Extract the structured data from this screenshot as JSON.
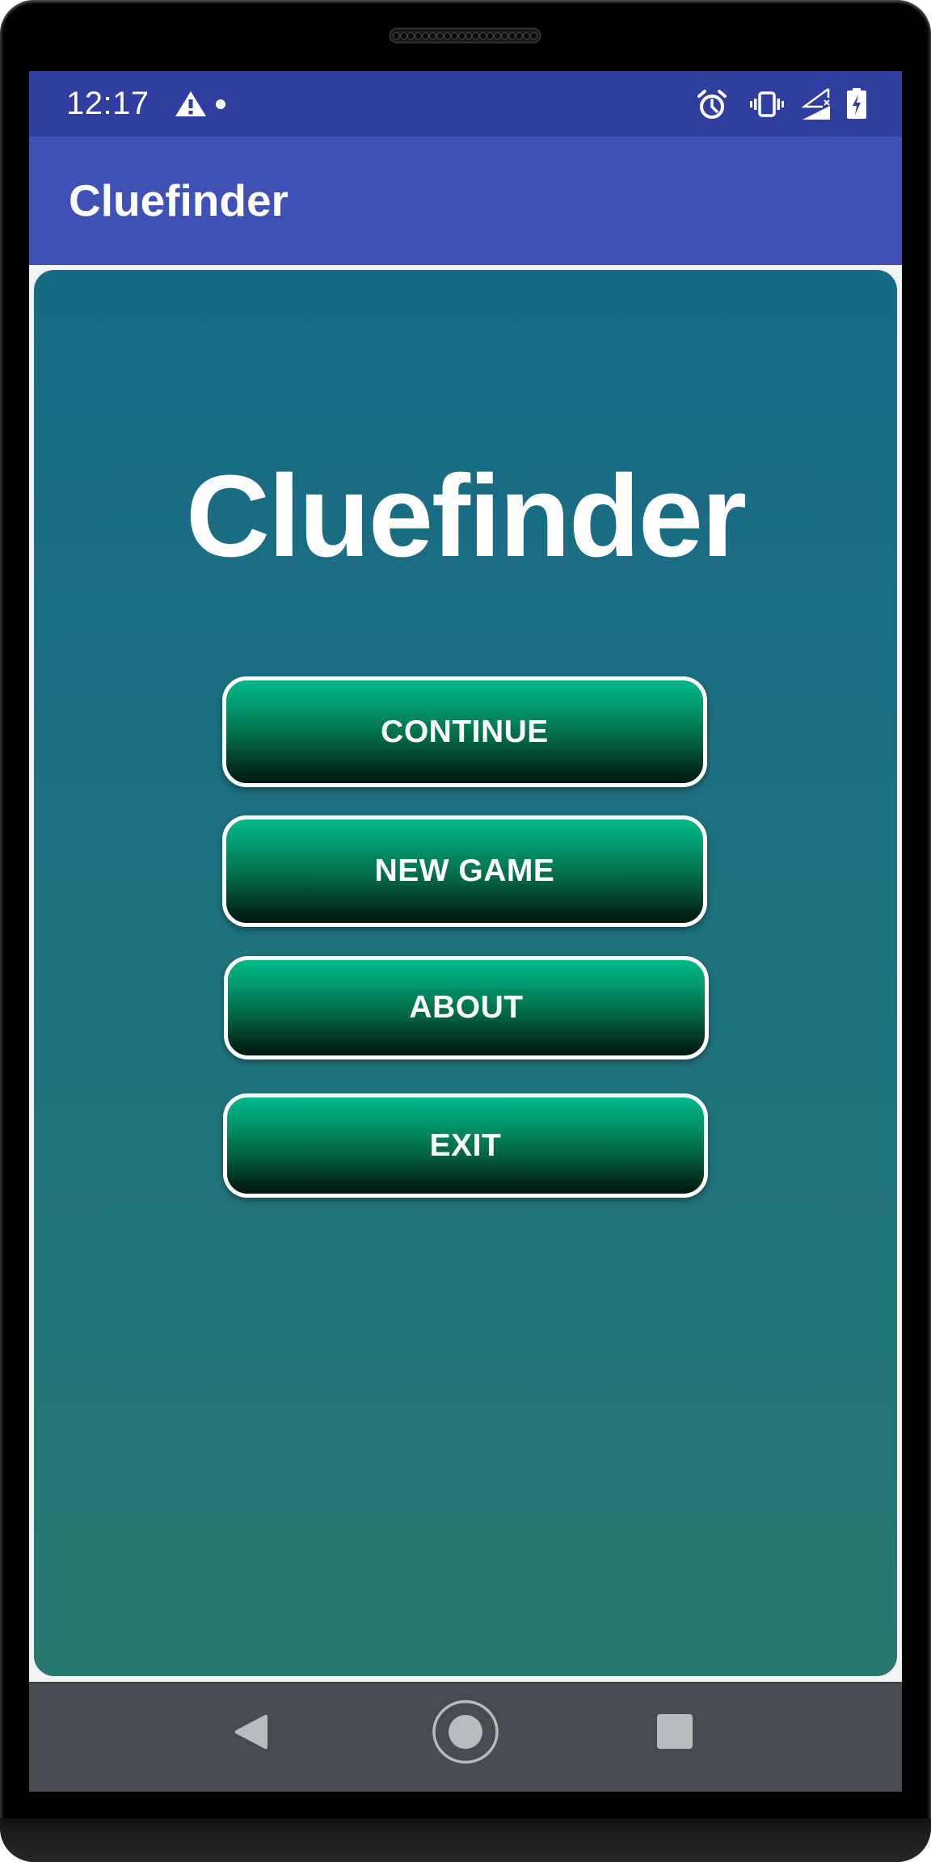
{
  "status_bar": {
    "time": "12:17",
    "left_icons": [
      "warning-icon",
      "notification-dot-icon"
    ],
    "right_icons": [
      "alarm-icon",
      "vibrate-icon",
      "signal-no-data-icon",
      "battery-charging-icon"
    ]
  },
  "app_bar": {
    "title": "Cluefinder",
    "background": "#3f51b5",
    "status_background": "#303f9f"
  },
  "main": {
    "title": "Cluefinder",
    "buttons": [
      {
        "label": "CONTINUE"
      },
      {
        "label": "NEW GAME"
      },
      {
        "label": "ABOUT"
      },
      {
        "label": "EXIT"
      }
    ],
    "card_gradient": [
      "#166a86",
      "#27796f"
    ],
    "button_gradient": [
      "#00b98a",
      "#001a10"
    ]
  },
  "nav_bar": {
    "buttons": [
      "back-icon",
      "home-icon",
      "recents-icon"
    ],
    "background": "#464c52",
    "icon_color": "#b9bcbe"
  }
}
